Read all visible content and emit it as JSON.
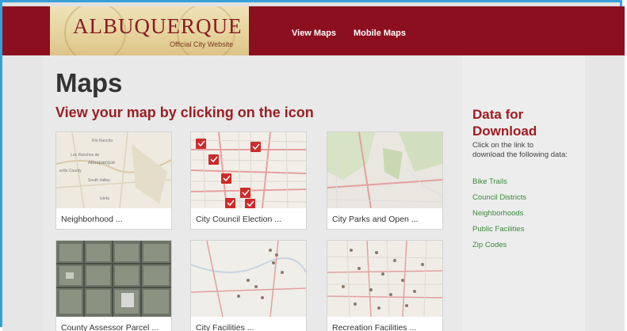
{
  "header": {
    "logo_title": "ALBUQUERQUE",
    "logo_subtitle": "Official City Website",
    "nav": [
      {
        "label": "View Maps"
      },
      {
        "label": "Mobile Maps"
      }
    ]
  },
  "main": {
    "title": "Maps",
    "subtitle": "View your map by clicking on the icon",
    "maps": [
      {
        "caption": "Neighborhood ...",
        "thumb": "neighborhood-map"
      },
      {
        "caption": "City Council Election ...",
        "thumb": "council-map"
      },
      {
        "caption": "City Parks and Open ...",
        "thumb": "parks-map"
      },
      {
        "caption": "County Assessor Parcel ...",
        "thumb": "aerial-map"
      },
      {
        "caption": "City Facilities ...",
        "thumb": "facilities-map"
      },
      {
        "caption": "Recreation Facilities ...",
        "thumb": "recreation-map"
      }
    ]
  },
  "sidebar": {
    "heading_line1": "Data for",
    "heading_line2": "Download",
    "description": "Click on the link to download the following data:",
    "links": [
      {
        "label": "Bike Trails"
      },
      {
        "label": "Council Districts"
      },
      {
        "label": "Neighborhoods"
      },
      {
        "label": "Public Facilities"
      },
      {
        "label": "Zip Codes"
      }
    ]
  },
  "colors": {
    "header_bg": "#8b0f1f",
    "heading_red": "#9b1e22",
    "link_green": "#3a8a3a",
    "frame_blue": "#38a0d8"
  }
}
